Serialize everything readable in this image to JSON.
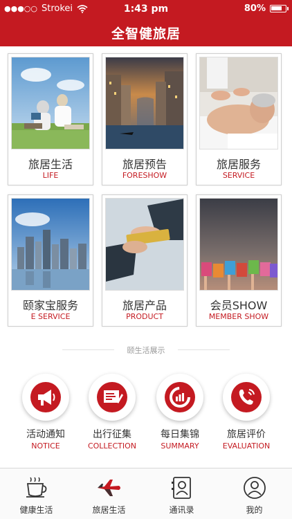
{
  "status_bar": {
    "signal_dots": "●●●○○",
    "carrier": "Strokei",
    "time": "1:43 pm",
    "battery_text": "80%",
    "battery_level": 0.8
  },
  "header": {
    "title": "全智健旅居"
  },
  "grid": [
    {
      "cn": "旅居生活",
      "en": "LIFE",
      "image": "elderly-couple-reading-photo"
    },
    {
      "cn": "旅居预告",
      "en": "FORESHOW",
      "image": "venice-canal-photo"
    },
    {
      "cn": "旅居服务",
      "en": "SERVICE",
      "image": "massage-photo"
    },
    {
      "cn": "颐家宝服务",
      "en": "E SERVICE",
      "image": "city-skyline-photo"
    },
    {
      "cn": "旅居产品",
      "en": "PRODUCT",
      "image": "card-handover-photo"
    },
    {
      "cn": "会员SHOW",
      "en": "MEMBER SHOW",
      "image": "member-letters-photo"
    }
  ],
  "section": {
    "label": "颐生活展示"
  },
  "features": [
    {
      "cn": "活动通知",
      "en": "NOTICE",
      "icon": "megaphone-icon"
    },
    {
      "cn": "出行征集",
      "en": "COLLECTION",
      "icon": "form-icon"
    },
    {
      "cn": "每日集锦",
      "en": "SUMMARY",
      "icon": "chart-donut-icon"
    },
    {
      "cn": "旅居评价",
      "en": "EVALUATION",
      "icon": "phone-icon"
    }
  ],
  "tabs": [
    {
      "label": "健康生活",
      "icon": "coffee-cup-icon"
    },
    {
      "label": "旅居生活",
      "icon": "airplane-icon",
      "active": true
    },
    {
      "label": "通讯录",
      "icon": "contacts-icon"
    },
    {
      "label": "我的",
      "icon": "user-icon"
    }
  ],
  "colors": {
    "accent": "#c41a21",
    "text": "#333333"
  }
}
